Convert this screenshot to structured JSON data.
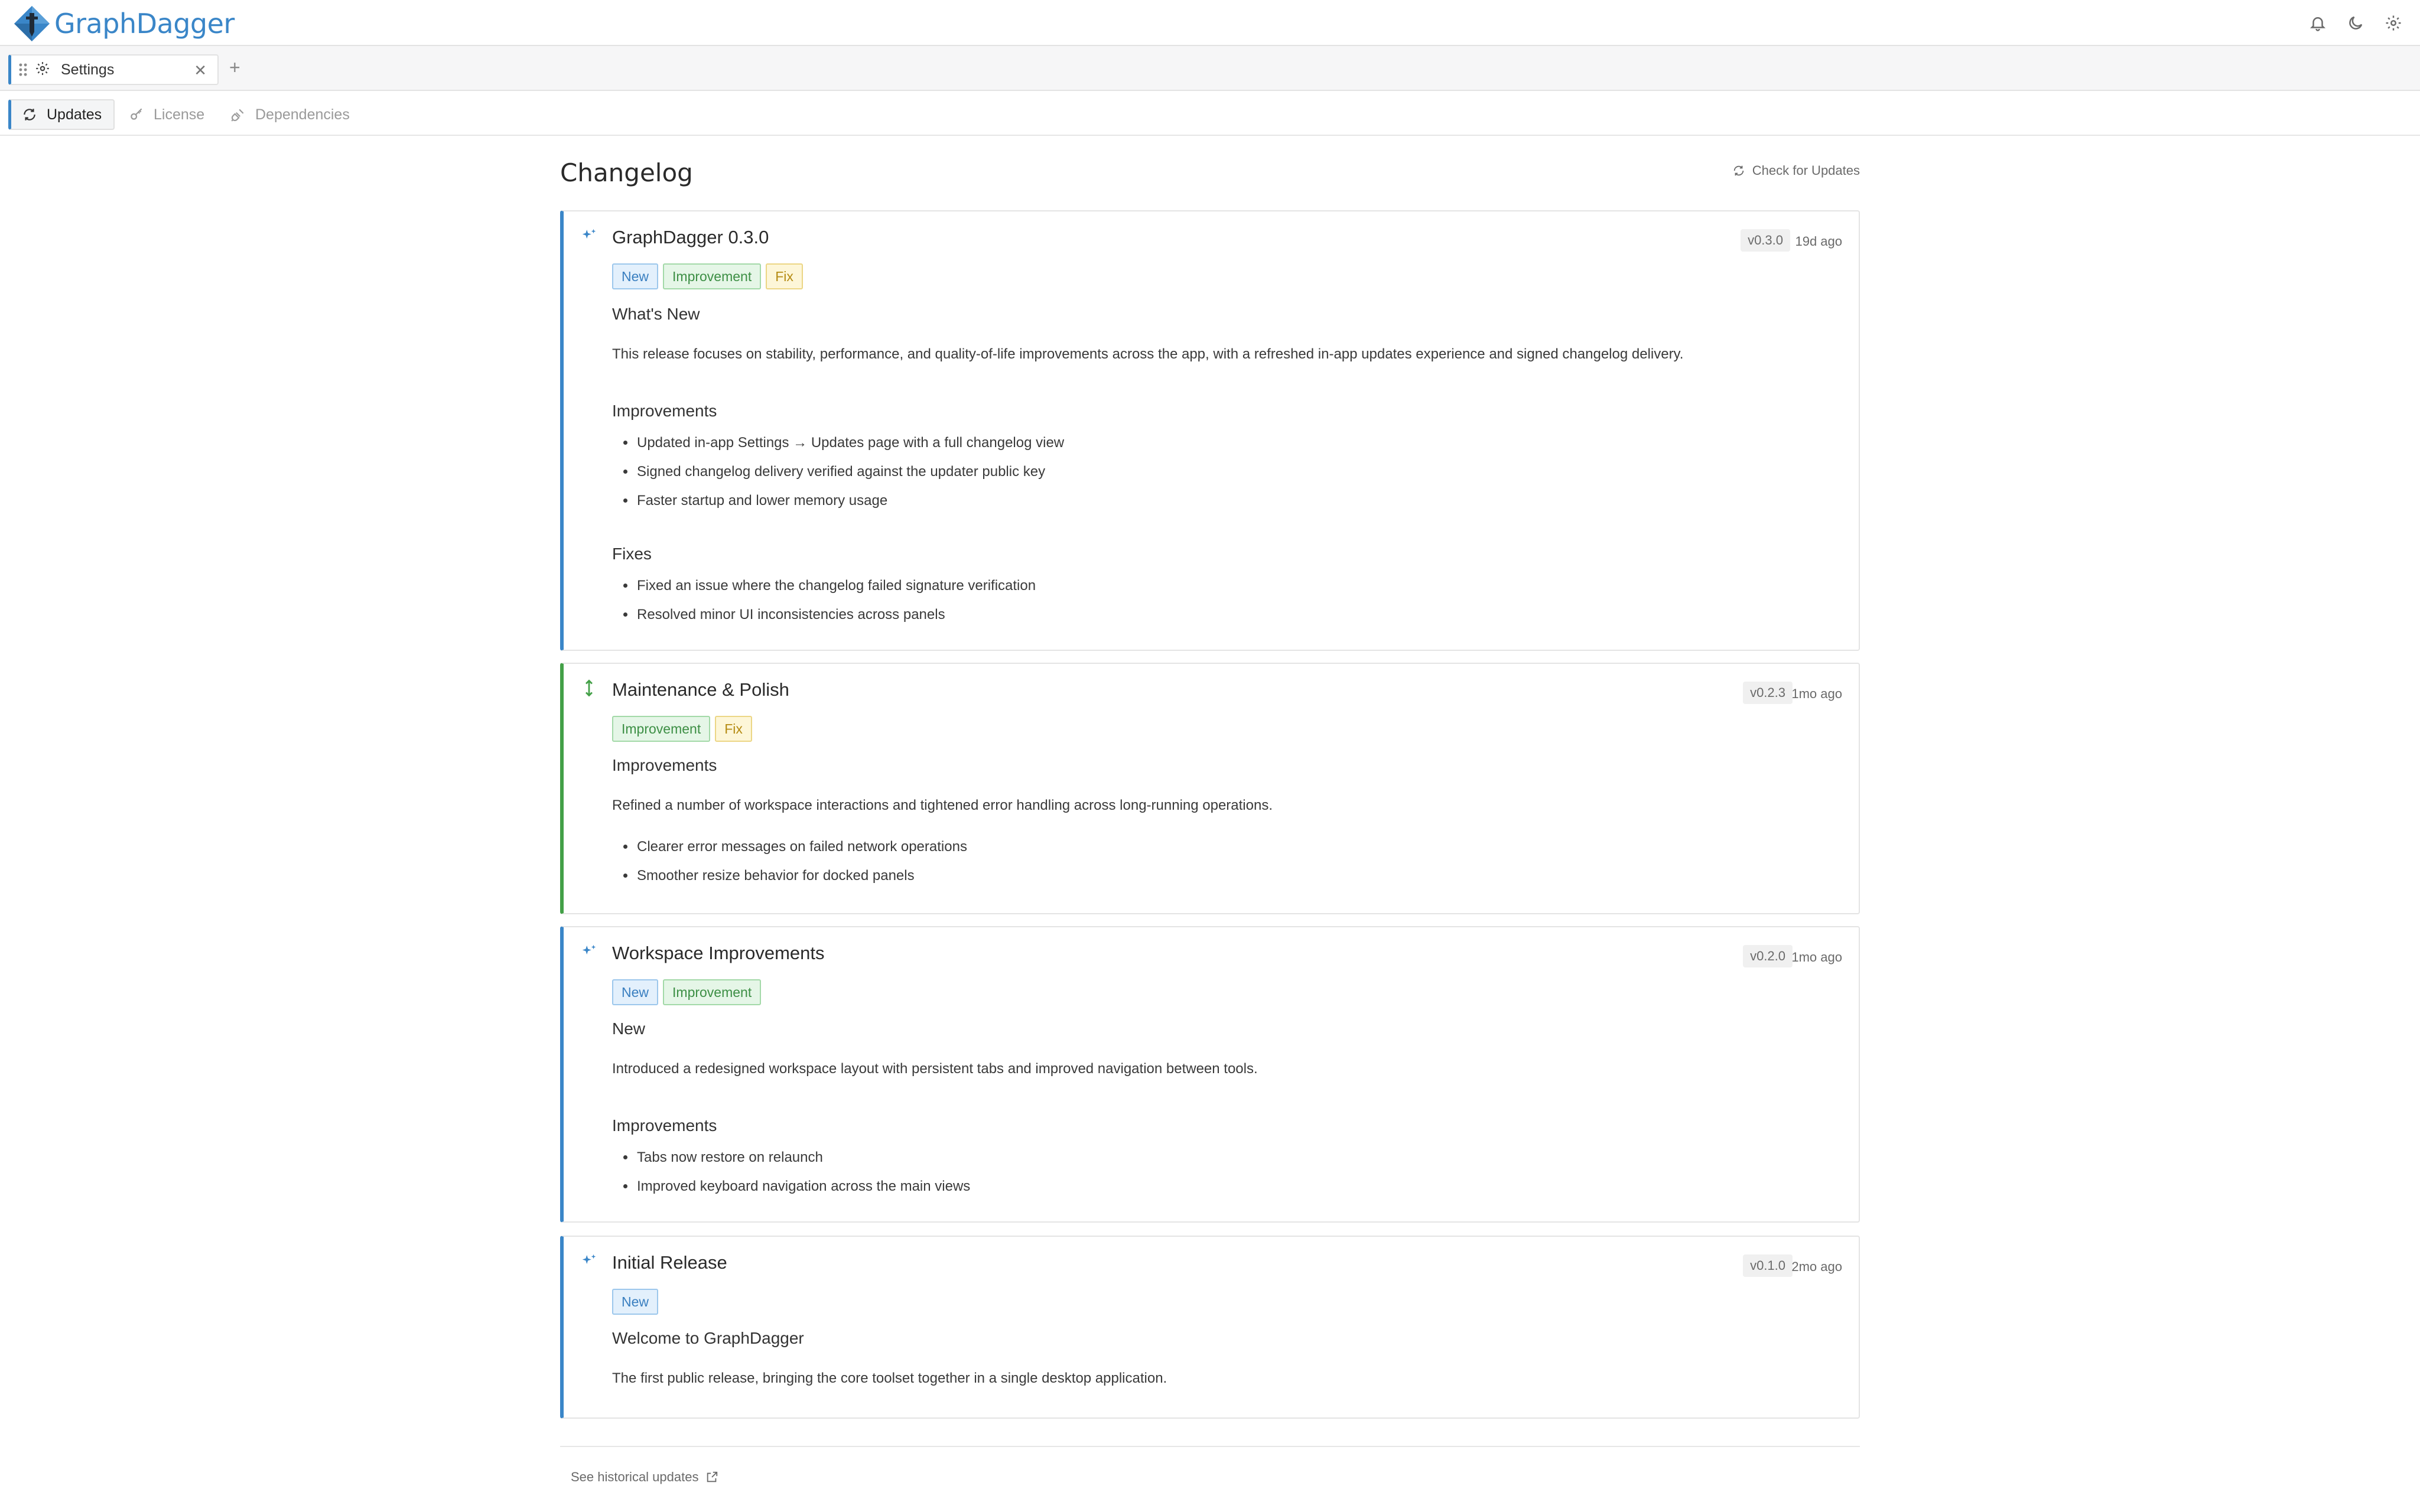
{
  "app": {
    "name": "GraphDagger"
  },
  "tabs": [
    {
      "label": "Settings"
    }
  ],
  "subnav": [
    {
      "label": "Updates"
    },
    {
      "label": "License"
    },
    {
      "label": "Dependencies"
    }
  ],
  "page": {
    "title": "Changelog",
    "check_updates_label": "Check for Updates",
    "historical_label": "See historical updates"
  },
  "colors": {
    "accent": "#3a86c8",
    "green": "#43a047",
    "badge_new": "#3a7fc0",
    "badge_improvement": "#3d8f45",
    "badge_fix": "#b58b13"
  },
  "icons": {
    "header": [
      "bell-icon",
      "moon-icon",
      "gear-icon"
    ],
    "release": [
      "sparkles-icon",
      "arrows-vertical-icon"
    ]
  },
  "releases": [
    {
      "title": "GraphDagger 0.3.0",
      "version": "v0.3.0",
      "ago": "19d ago",
      "badges": [
        "New",
        "Improvement",
        "Fix"
      ],
      "sections": [
        {
          "heading": "What's New",
          "text": "This release focuses on stability, performance, and quality-of-life improvements across the app, with a refreshed in-app updates experience and signed changelog delivery."
        },
        {
          "heading": "Improvements",
          "items": [
            "Updated in-app Settings → Updates page with a full changelog view",
            "Signed changelog delivery verified against the updater public key",
            "Faster startup and lower memory usage"
          ]
        },
        {
          "heading": "Fixes",
          "items": [
            "Fixed an issue where the changelog failed signature verification",
            "Resolved minor UI inconsistencies across panels"
          ]
        }
      ]
    },
    {
      "title": "Maintenance & Polish",
      "version": "v0.2.3",
      "ago": "1mo ago",
      "badges": [
        "Improvement",
        "Fix"
      ],
      "sections": [
        {
          "heading": "Improvements",
          "text": "Refined a number of workspace interactions and tightened error handling across long-running operations.",
          "items": [
            "Clearer error messages on failed network operations",
            "Smoother resize behavior for docked panels"
          ]
        }
      ]
    },
    {
      "title": "Workspace Improvements",
      "version": "v0.2.0",
      "ago": "1mo ago",
      "badges": [
        "New",
        "Improvement"
      ],
      "sections": [
        {
          "heading": "New",
          "text": "Introduced a redesigned workspace layout with persistent tabs and improved navigation between tools."
        },
        {
          "heading": "Improvements",
          "items": [
            "Tabs now restore on relaunch",
            "Improved keyboard navigation across the main views"
          ]
        }
      ]
    },
    {
      "title": "Initial Release",
      "version": "v0.1.0",
      "ago": "2mo ago",
      "badges": [
        "New"
      ],
      "sections": [
        {
          "heading": "Welcome to GraphDagger",
          "text": "The first public release, bringing the core toolset together in a single desktop application."
        }
      ]
    }
  ]
}
